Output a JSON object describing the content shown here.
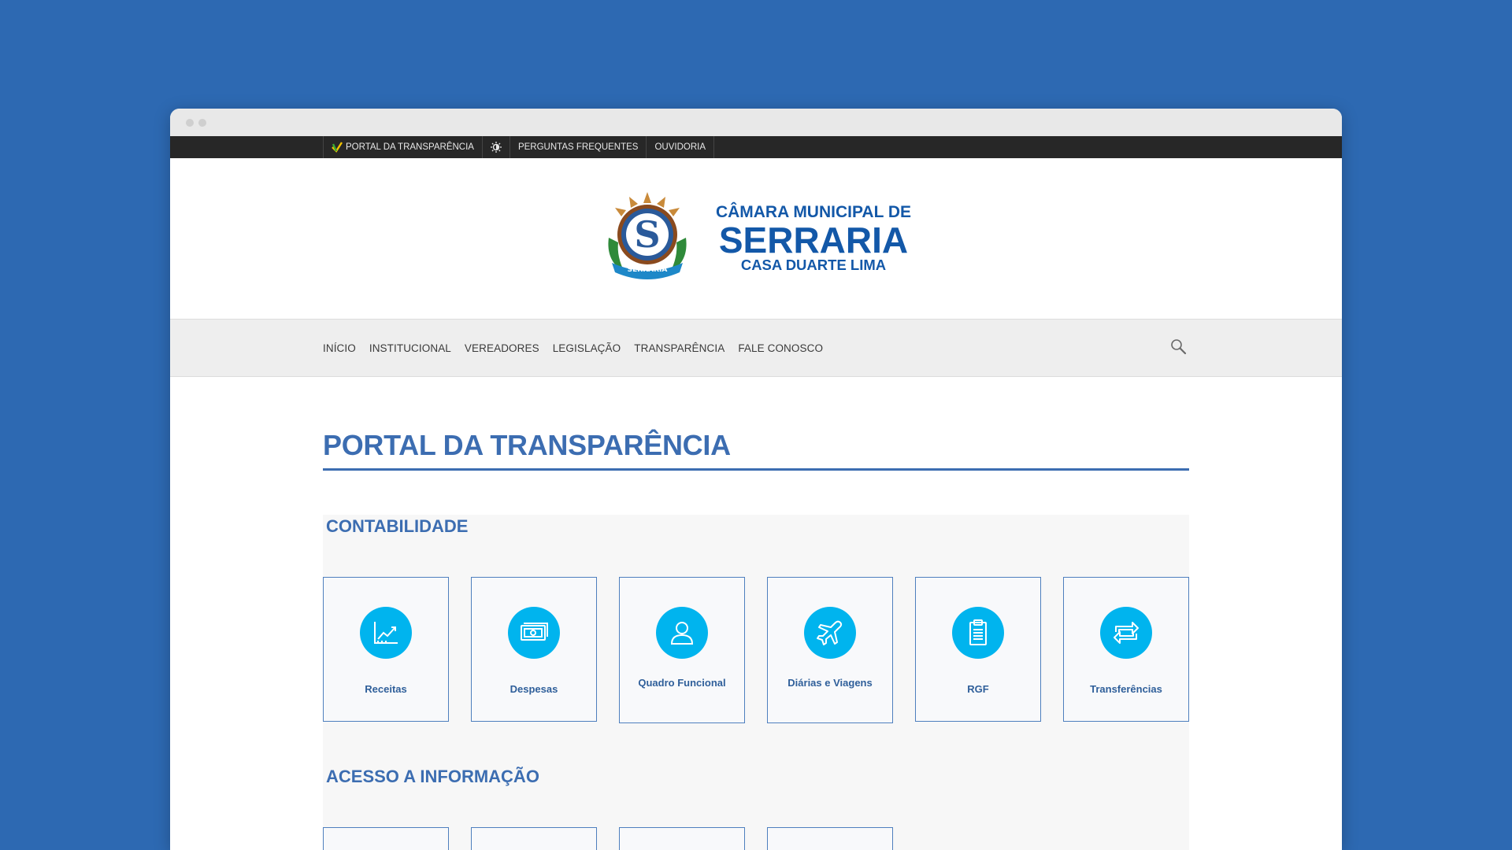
{
  "topbar": {
    "items": [
      {
        "label": "PORTAL DA TRANSPARÊNCIA",
        "icon": "transparency-leaf-icon"
      },
      {
        "label": "",
        "icon": "brightness-icon"
      },
      {
        "label": "PERGUNTAS FREQUENTES"
      },
      {
        "label": "OUVIDORIA"
      }
    ]
  },
  "brand": {
    "line1": "CÂMARA MUNICIPAL DE",
    "line2": "SERRARIA",
    "line3": "CASA DUARTE LIMA",
    "crest_text": "SERRARIA",
    "crest_letter": "S",
    "color": "#1358a8"
  },
  "nav": {
    "items": [
      "INÍCIO",
      "INSTITUCIONAL",
      "VEREADORES",
      "LEGISLAÇÃO",
      "TRANSPARÊNCIA",
      "FALE CONOSCO"
    ],
    "search_icon": "search-icon"
  },
  "page": {
    "title": "PORTAL DA TRANSPARÊNCIA",
    "title_color": "#3c6db1"
  },
  "sections": [
    {
      "title": "CONTABILIDADE",
      "cards": [
        {
          "label": "Receitas",
          "icon": "chart-up-icon"
        },
        {
          "label": "Despesas",
          "icon": "money-icon"
        },
        {
          "label": "Quadro Funcional",
          "icon": "user-icon"
        },
        {
          "label": "Diárias e Viagens",
          "icon": "airplane-icon"
        },
        {
          "label": "RGF",
          "icon": "clipboard-icon"
        },
        {
          "label": "Transferências",
          "icon": "transfer-icon"
        }
      ]
    },
    {
      "title": "ACESSO A INFORMAÇÃO"
    }
  ],
  "colors": {
    "background": "#2d69b2",
    "icon_circle": "#00b4ee",
    "card_border": "#4e7fbe",
    "topbar": "#272727"
  }
}
